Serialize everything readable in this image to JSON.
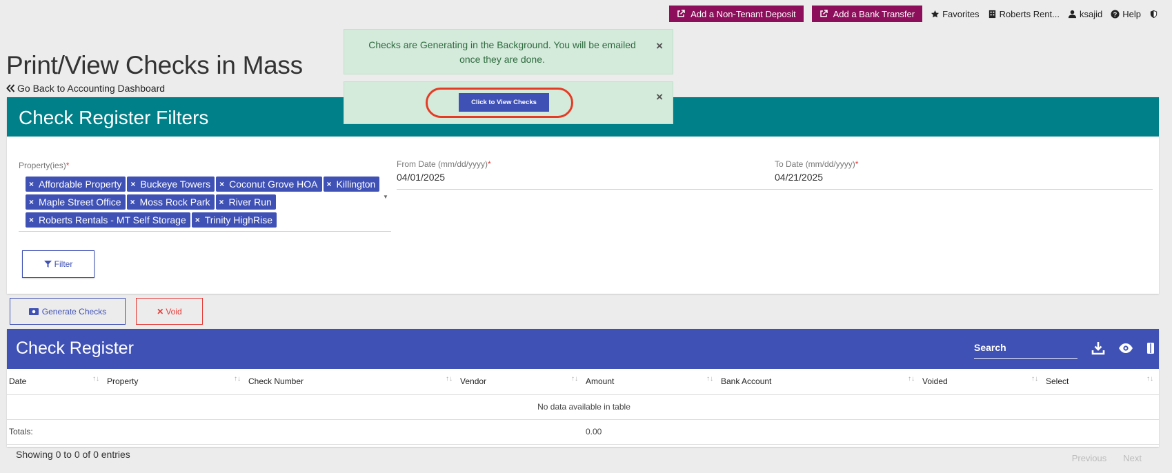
{
  "topnav": {
    "deposit_label": "Add a Non-Tenant Deposit",
    "transfer_label": "Add a Bank Transfer",
    "favorites": "Favorites",
    "company": "Roberts Rent...",
    "user": "ksajid",
    "help": "Help"
  },
  "page": {
    "title": "Print/View Checks in Mass",
    "back_link": "Go Back to Accounting Dashboard"
  },
  "alerts": {
    "generating": "Checks are Generating in the Background. You will be emailed once they are done.",
    "close": "×",
    "view_checks_label": "Click to View Checks"
  },
  "filters": {
    "title": "Check Register Filters",
    "property_label": "Property(ies)",
    "required_mark": "*",
    "properties": [
      "Affordable Property",
      "Buckeye Towers",
      "Coconut Grove HOA",
      "Killington",
      "Maple Street Office",
      "Moss Rock Park",
      "River Run",
      "Roberts Rentals - MT Self Storage",
      "Trinity HighRise"
    ],
    "from_label": "From Date (mm/dd/yyyy)",
    "from_value": "04/01/2025",
    "to_label": "To Date (mm/dd/yyyy)",
    "to_value": "04/21/2025",
    "filter_label": "Filter"
  },
  "actions": {
    "generate_label": "Generate Checks",
    "void_label": "Void"
  },
  "register": {
    "title": "Check Register",
    "search_placeholder": "Search",
    "columns": [
      "Date",
      "Property",
      "Check Number",
      "Vendor",
      "Amount",
      "Bank Account",
      "Voided",
      "Select"
    ],
    "empty_message": "No data available in table",
    "totals_label": "Totals:",
    "totals_amount": "0.00"
  },
  "footer": {
    "info": "Showing 0 to 0 of 0 entries",
    "previous": "Previous",
    "next": "Next"
  },
  "colors": {
    "nav_button": "#8d0e5b",
    "filter_header": "#008089",
    "primary": "#3f51b5",
    "danger": "#e53935",
    "alert_bg": "#d4eadb",
    "highlight": "#e53b24"
  }
}
